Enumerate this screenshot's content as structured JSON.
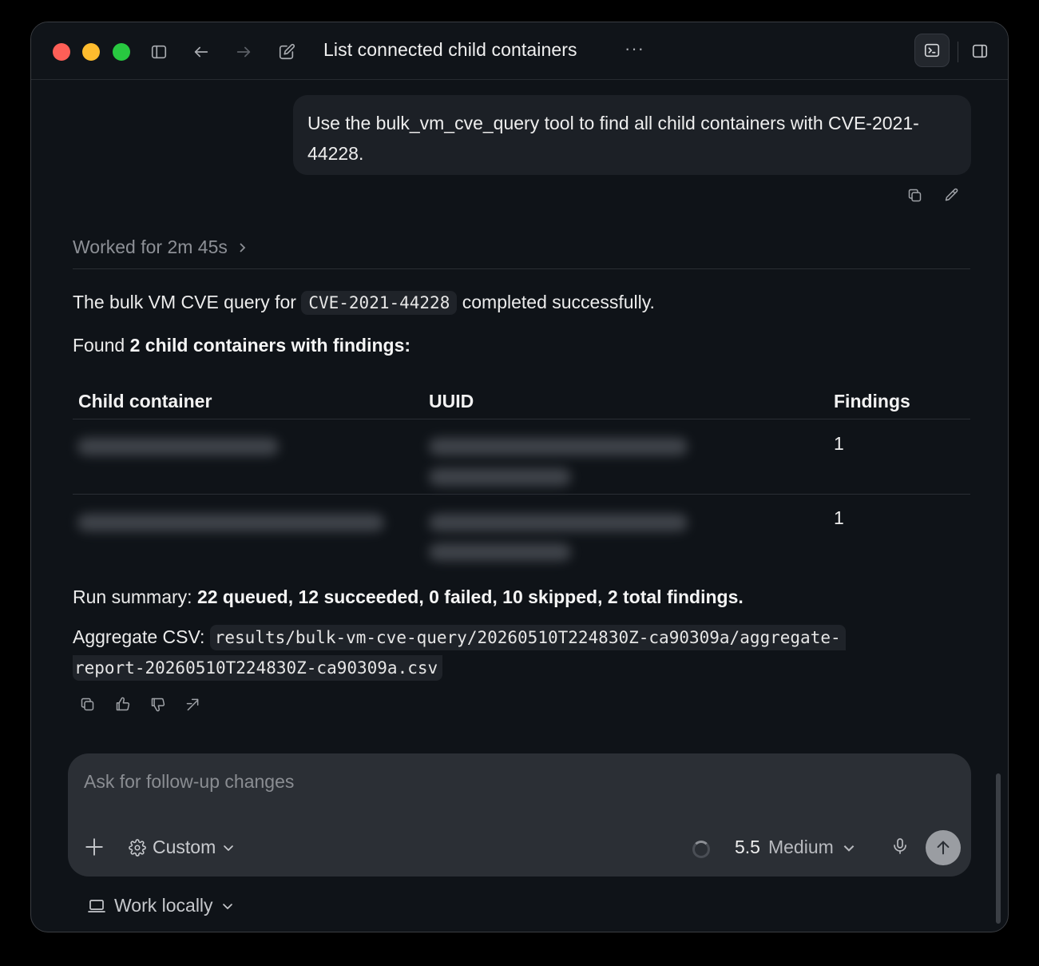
{
  "window": {
    "title": "List connected child containers",
    "more_label": "···"
  },
  "user_message": {
    "text": "Use the bulk_vm_cve_query tool to find all child containers with CVE-2021-44228."
  },
  "worked": {
    "label": "Worked for 2m 45s"
  },
  "response": {
    "line1_prefix": "The bulk VM CVE query for",
    "line1_code": "CVE-2021-44228",
    "line1_suffix": "completed successfully.",
    "line2_prefix": "Found",
    "line2_bold": "2 child containers with findings:",
    "table": {
      "headers": [
        "Child container",
        "UUID",
        "Findings"
      ],
      "rows": [
        {
          "container": "[redacted]",
          "uuid": "[redacted]",
          "findings": "1"
        },
        {
          "container": "[redacted]",
          "uuid": "[redacted]",
          "findings": "1"
        }
      ]
    },
    "summary_prefix": "Run summary:",
    "summary_bold": "22 queued, 12 succeeded, 0 failed, 10 skipped, 2 total findings.",
    "csv_prefix": "Aggregate CSV:",
    "csv_path_line1": "results/bulk-vm-cve-query/20260510T224830Z-ca90309a/aggregate-",
    "csv_path_line2": "report-20260510T224830Z-ca90309a.csv"
  },
  "composer": {
    "placeholder": "Ask for follow-up changes",
    "mode_label": "Custom",
    "model_version": "5.5",
    "model_level": "Medium"
  },
  "footer": {
    "work_locally_label": "Work locally"
  },
  "colors": {
    "background": "#0f1318",
    "bubble": "#1c2026",
    "composer": "#2b2f35",
    "traffic_red": "#fe5f57",
    "traffic_yellow": "#febc2e",
    "traffic_green": "#28c840"
  },
  "icons": [
    "sidebar-toggle-icon",
    "arrow-left-icon",
    "arrow-right-icon",
    "compose-icon",
    "terminal-icon",
    "panel-icon",
    "copy-icon",
    "pencil-icon",
    "chevron-right-icon",
    "thumbs-up-icon",
    "thumbs-down-icon",
    "share-icon",
    "plus-icon",
    "gear-icon",
    "chevron-down-icon",
    "spinner-icon",
    "mic-icon",
    "arrow-up-icon",
    "laptop-icon"
  ]
}
